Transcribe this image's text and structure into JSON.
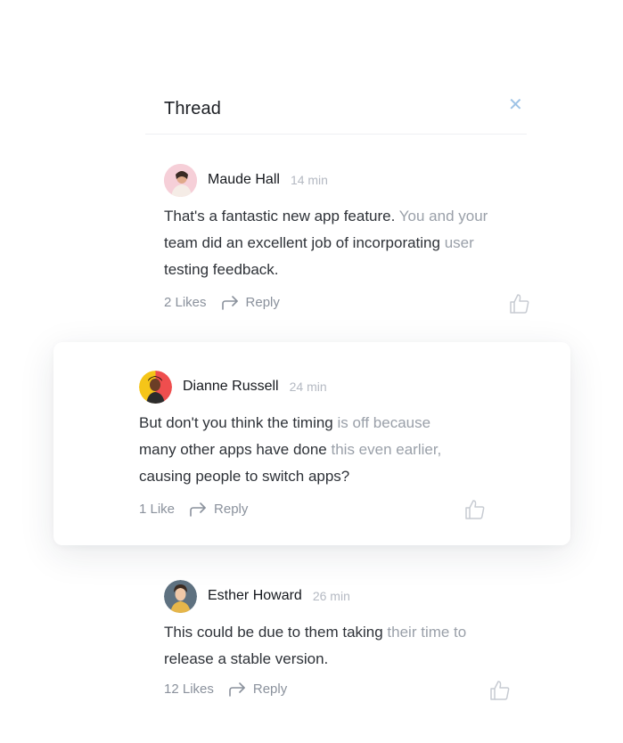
{
  "panel": {
    "title": "Thread",
    "close_icon": "close-icon",
    "accent": "#9ec3e6"
  },
  "comments": [
    {
      "author": "Maude Hall",
      "time": "14 min",
      "lines": [
        {
          "dark": "That's a fantastic new app feature.",
          "light": " You and your"
        },
        {
          "dark": "team did an excellent job of incorporating",
          "light": " user"
        },
        {
          "dark": "testing feedback.",
          "light": ""
        }
      ],
      "likes_label": "2 Likes",
      "reply_label": "Reply",
      "highlighted": false
    },
    {
      "author": "Dianne Russell",
      "time": "24 min",
      "lines": [
        {
          "dark": "But don't you think the timing",
          "light": " is off because"
        },
        {
          "dark": "many other apps have done",
          "light": " this even earlier,"
        },
        {
          "dark": "causing people to switch apps?",
          "light": ""
        }
      ],
      "likes_label": "1 Like",
      "reply_label": "Reply",
      "highlighted": true
    },
    {
      "author": "Esther Howard",
      "time": "26 min",
      "lines": [
        {
          "dark": "This could be due to them taking",
          "light": " their time to"
        },
        {
          "dark": "release a stable version.",
          "light": ""
        }
      ],
      "likes_label": "12 Likes",
      "reply_label": "Reply",
      "highlighted": false
    }
  ]
}
